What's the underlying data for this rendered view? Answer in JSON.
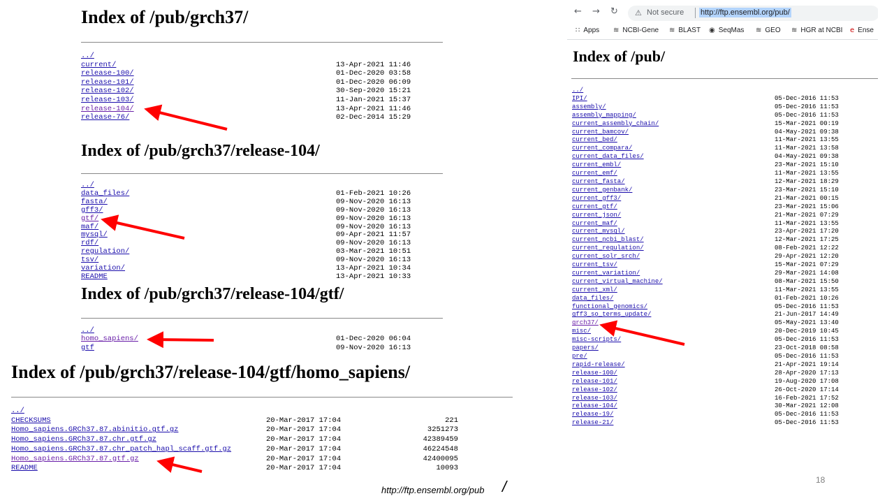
{
  "listing1": {
    "title": "Index of /pub/grch37/",
    "entries": [
      {
        "name": "../",
        "date": ""
      },
      {
        "name": "current/",
        "date": "13-Apr-2021 11:46"
      },
      {
        "name": "release-100/",
        "date": "01-Dec-2020 03:58"
      },
      {
        "name": "release-101/",
        "date": "01-Dec-2020 06:09"
      },
      {
        "name": "release-102/",
        "date": "30-Sep-2020 15:21"
      },
      {
        "name": "release-103/",
        "date": "11-Jan-2021 15:37"
      },
      {
        "name": "release-104/",
        "date": "13-Apr-2021 11:46"
      },
      {
        "name": "release-76/",
        "date": "02-Dec-2014 15:29"
      }
    ]
  },
  "listing2": {
    "title": "Index of /pub/grch37/release-104/",
    "entries": [
      {
        "name": "../",
        "date": ""
      },
      {
        "name": "data_files/",
        "date": "01-Feb-2021 10:26"
      },
      {
        "name": "fasta/",
        "date": "09-Nov-2020 16:13"
      },
      {
        "name": "gff3/",
        "date": "09-Nov-2020 16:13"
      },
      {
        "name": "gtf/",
        "date": "09-Nov-2020 16:13"
      },
      {
        "name": "maf/",
        "date": "09-Nov-2020 16:13"
      },
      {
        "name": "mysql/",
        "date": "09-Apr-2021 11:57"
      },
      {
        "name": "rdf/",
        "date": "09-Nov-2020 16:13"
      },
      {
        "name": "regulation/",
        "date": "03-Mar-2021 10:51"
      },
      {
        "name": "tsv/",
        "date": "09-Nov-2020 16:13"
      },
      {
        "name": "variation/",
        "date": "13-Apr-2021 10:34"
      },
      {
        "name": "README",
        "date": "13-Apr-2021 10:33"
      }
    ]
  },
  "listing3": {
    "title": "Index of /pub/grch37/release-104/gtf/",
    "entries": [
      {
        "name": "../",
        "date": ""
      },
      {
        "name": "homo_sapiens/",
        "date": "01-Dec-2020 06:04"
      },
      {
        "name": "gtf",
        "date": "09-Nov-2020 16:13"
      }
    ]
  },
  "listing4": {
    "title": "Index of /pub/grch37/release-104/gtf/homo_sapiens/",
    "entries": [
      {
        "name": "../",
        "date": "",
        "size": ""
      },
      {
        "name": "CHECKSUMS",
        "date": "20-Mar-2017 17:04",
        "size": "221"
      },
      {
        "name": "Homo_sapiens.GRCh37.87.abinitio.gtf.gz",
        "date": "20-Mar-2017 17:04",
        "size": "3251273"
      },
      {
        "name": "Homo_sapiens.GRCh37.87.chr.gtf.gz",
        "date": "20-Mar-2017 17:04",
        "size": "42389459"
      },
      {
        "name": "Homo_sapiens.GRCh37.87.chr_patch_hapl_scaff.gtf.gz",
        "date": "20-Mar-2017 17:04",
        "size": "46224548"
      },
      {
        "name": "Homo_sapiens.GRCh37.87.gtf.gz",
        "date": "20-Mar-2017 17:04",
        "size": "42400095"
      },
      {
        "name": "README",
        "date": "20-Mar-2017 17:04",
        "size": "10093"
      }
    ]
  },
  "browser": {
    "security_label": "Not secure",
    "url": "http://ftp.ensembl.org/pub/",
    "bookmarks": [
      "Apps",
      "NCBI-Gene",
      "BLAST",
      "SeqMas",
      "GEO",
      "HGR at NCBI",
      "Ense"
    ],
    "title": "Index of /pub/",
    "entries": [
      {
        "name": "../",
        "date": ""
      },
      {
        "name": "IPI/",
        "date": "05-Dec-2016 11:53"
      },
      {
        "name": "assembly/",
        "date": "05-Dec-2016 11:53"
      },
      {
        "name": "assembly_mapping/",
        "date": "05-Dec-2016 11:53"
      },
      {
        "name": "current_assembly_chain/",
        "date": "15-Mar-2021 00:19"
      },
      {
        "name": "current_bamcov/",
        "date": "04-May-2021 09:38"
      },
      {
        "name": "current_bed/",
        "date": "11-Mar-2021 13:55"
      },
      {
        "name": "current_compara/",
        "date": "11-Mar-2021 13:58"
      },
      {
        "name": "current_data_files/",
        "date": "04-May-2021 09:38"
      },
      {
        "name": "current_embl/",
        "date": "23-Mar-2021 15:10"
      },
      {
        "name": "current_emf/",
        "date": "11-Mar-2021 13:55"
      },
      {
        "name": "current_fasta/",
        "date": "12-Mar-2021 18:29"
      },
      {
        "name": "current_genbank/",
        "date": "23-Mar-2021 15:10"
      },
      {
        "name": "current_gff3/",
        "date": "21-Mar-2021 00:15"
      },
      {
        "name": "current_gtf/",
        "date": "23-Mar-2021 15:06"
      },
      {
        "name": "current_json/",
        "date": "21-Mar-2021 07:29"
      },
      {
        "name": "current_maf/",
        "date": "11-Mar-2021 13:55"
      },
      {
        "name": "current_mysql/",
        "date": "23-Apr-2021 17:20"
      },
      {
        "name": "current_ncbi_blast/",
        "date": "12-Mar-2021 17:25"
      },
      {
        "name": "current_regulation/",
        "date": "08-Feb-2021 12:22"
      },
      {
        "name": "current_solr_srch/",
        "date": "29-Apr-2021 12:20"
      },
      {
        "name": "current_tsv/",
        "date": "15-Mar-2021 07:29"
      },
      {
        "name": "current_variation/",
        "date": "29-Mar-2021 14:08"
      },
      {
        "name": "current_virtual_machine/",
        "date": "08-Mar-2021 15:50"
      },
      {
        "name": "current_xml/",
        "date": "11-Mar-2021 13:55"
      },
      {
        "name": "data_files/",
        "date": "01-Feb-2021 10:26"
      },
      {
        "name": "functional_genomics/",
        "date": "05-Dec-2016 11:53"
      },
      {
        "name": "gff3_so_terms_update/",
        "date": "21-Jun-2017 14:49"
      },
      {
        "name": "grch37/",
        "date": "05-May-2021 13:40"
      },
      {
        "name": "misc/",
        "date": "20-Dec-2019 10:45"
      },
      {
        "name": "misc-scripts/",
        "date": "05-Dec-2016 11:53"
      },
      {
        "name": "papers/",
        "date": "23-Oct-2018 08:58"
      },
      {
        "name": "pre/",
        "date": "05-Dec-2016 11:53"
      },
      {
        "name": "rapid-release/",
        "date": "21-Apr-2021 19:14"
      },
      {
        "name": "release-100/",
        "date": "28-Apr-2020 17:13"
      },
      {
        "name": "release-101/",
        "date": "19-Aug-2020 17:08"
      },
      {
        "name": "release-102/",
        "date": "26-Oct-2020 17:14"
      },
      {
        "name": "release-103/",
        "date": "16-Feb-2021 17:52"
      },
      {
        "name": "release-104/",
        "date": "30-Mar-2021 12:08"
      },
      {
        "name": "release-19/",
        "date": "05-Dec-2016 11:53"
      },
      {
        "name": "release-21/",
        "date": "05-Dec-2016 11:53"
      }
    ]
  },
  "caption": "http://ftp.ensembl.org/pub",
  "caption_slash": "/",
  "slide_number": "18",
  "colors": {
    "link": "#1a0dab",
    "visited": "#681da8",
    "arrow": "#ff0000"
  }
}
